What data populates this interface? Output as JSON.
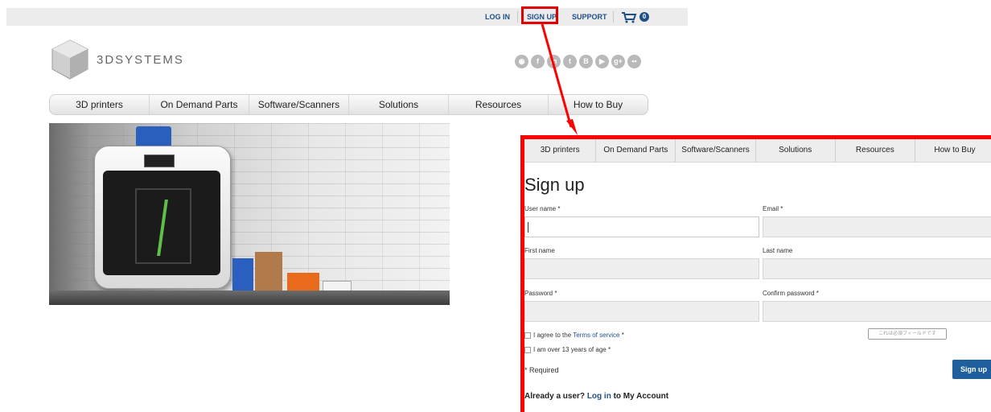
{
  "topbar": {
    "login": "LOG IN",
    "signup": "SIGN UP",
    "support": "SUPPORT",
    "cart_count": "0"
  },
  "brand": {
    "name": "3DSYSTEMS"
  },
  "social": [
    "rss-icon",
    "facebook-icon",
    "linkedin-icon",
    "twitter-icon",
    "blogger-icon",
    "youtube-icon",
    "google-plus-icon",
    "flickr-icon"
  ],
  "social_glyphs": [
    "◉",
    "f",
    "in",
    "t",
    "B",
    "▶",
    "g+",
    "••"
  ],
  "nav": [
    "3D printers",
    "On Demand Parts",
    "Software/Scanners",
    "Solutions",
    "Resources",
    "How to Buy"
  ],
  "signup_form": {
    "heading": "Sign up",
    "username_label": "User name *",
    "email_label": "Email *",
    "firstname_label": "First name",
    "lastname_label": "Last name",
    "password_label": "Password *",
    "confirm_label": "Confirm password *",
    "terms_prefix": "I agree to the ",
    "terms_link": "Terms of service",
    "terms_suffix": " *",
    "age_label": "I am over 13 years of age *",
    "required_note": "* Required",
    "tooltip": "これは必須フィールドです",
    "submit": "Sign up",
    "already_prefix": "Already a user? ",
    "already_link": "Log in",
    "already_suffix": " to My Account"
  },
  "colors": {
    "highlight": "#ff0000",
    "link": "#1f4f8a",
    "button": "#1f5f9e"
  }
}
